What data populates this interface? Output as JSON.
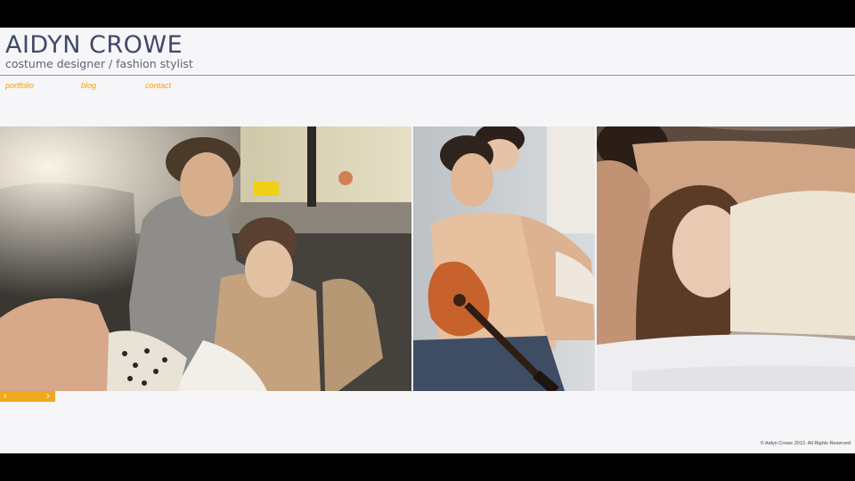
{
  "brand": {
    "name": "AIDYN CROWE",
    "tagline": "costume designer /  fashion stylist"
  },
  "nav": {
    "items": [
      {
        "label": "portfolio"
      },
      {
        "label": "blog"
      },
      {
        "label": "contact"
      }
    ]
  },
  "gallery": {
    "photos": [
      {
        "name": "couple-in-taxi-photo"
      },
      {
        "name": "couple-with-guitar-photo"
      },
      {
        "name": "couple-in-bed-photo"
      }
    ]
  },
  "slider": {
    "prev_icon": "chevron-left-icon",
    "next_icon": "chevron-right-icon"
  },
  "footer": {
    "copyright": "© Aidyn Crowe 2012. All Rights Reserved"
  },
  "colors": {
    "accent": "#f0a400",
    "brand_text": "#3f4a66",
    "page_bg": "#f6f5f8"
  }
}
